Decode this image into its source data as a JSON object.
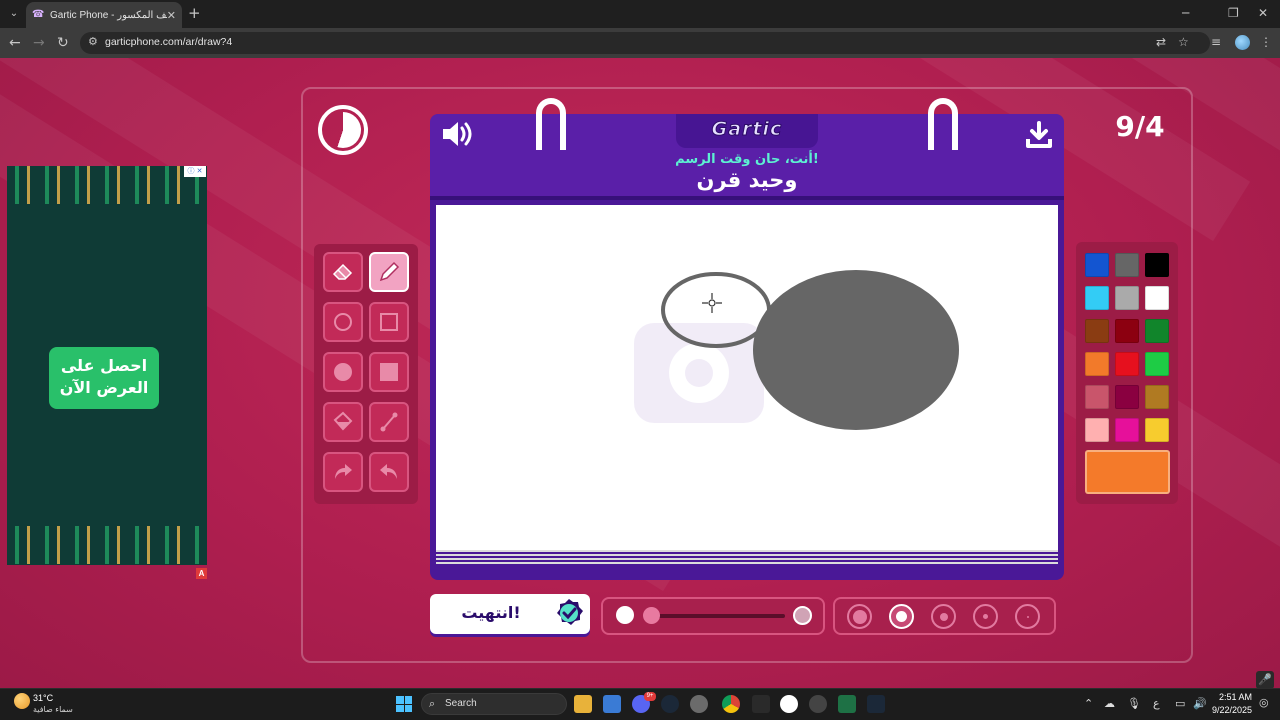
{
  "browser": {
    "tab_title": "Gartic Phone - الهاتف المكسور",
    "tab_favicon": "☎",
    "url": "garticphone.com/ar/draw?4"
  },
  "game": {
    "round": "9/4",
    "logo": "Gartic",
    "subtitle": "أنت، حان وقت الرسم!",
    "word": "وحيد قرن",
    "done_label": "انتهيت!",
    "active_tool": "pencil",
    "current_color": "#f47a2a",
    "palette": [
      "#1355d1",
      "#666666",
      "#000000",
      "#33ccf5",
      "#aaaaaa",
      "#ffffff",
      "#8a3c12",
      "#8c0010",
      "#11852b",
      "#f27a2a",
      "#e6101e",
      "#1ecc45",
      "#c9556b",
      "#8a0040",
      "#b07a22",
      "#ffb0b0",
      "#e6109a",
      "#f7cc2e"
    ],
    "selected_brush_size": 4,
    "timer_remaining": 0.55
  },
  "ad": {
    "cta": "احصل على العرض الآن",
    "badge": "A"
  },
  "taskbar": {
    "weather_temp": "31°C",
    "weather_desc": "سماء صافية",
    "search_placeholder": "Search",
    "time": "2:51 AM",
    "date": "9/22/2025",
    "lang": "ع",
    "notification_badge": "9+"
  }
}
